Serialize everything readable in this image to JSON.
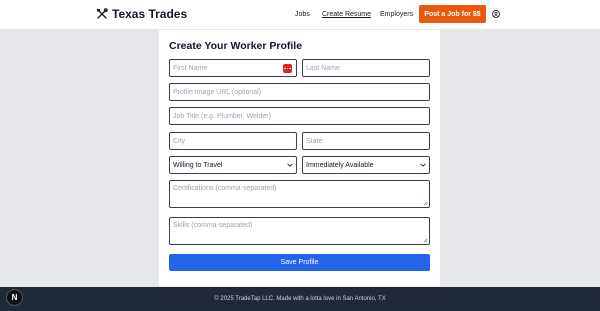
{
  "navbar": {
    "brand": "Texas Trades",
    "brand_icon": "tools-icon",
    "links": [
      "Jobs",
      "Create Resume",
      "Employers"
    ],
    "active_link": "Create Resume",
    "post_job_label": "Post a Job for $5",
    "user_icon": "user-circle-icon"
  },
  "form": {
    "title": "Create Your Worker Profile",
    "first_name_placeholder": "First Name",
    "last_name_placeholder": "Last Name",
    "profile_image_placeholder": "Profile Image URL (optional)",
    "job_title_placeholder": "Job Title (e.g. Plumber, Welder)",
    "city_placeholder": "City",
    "state_placeholder": "State",
    "travel_select_value": "Willing to Travel",
    "availability_select_value": "Immediately Available",
    "certifications_placeholder": "Certifications (comma-separated)",
    "skills_placeholder": "Skills (comma-separated)",
    "save_label": "Save Profile"
  },
  "footer": {
    "text": "© 2025 TradeTap LLC. Made with a lotta love in San Antonio, TX"
  },
  "dev_badge": "N",
  "colors": {
    "accent_orange": "#ea580c",
    "primary_blue": "#2563eb",
    "footer_bg": "#1f2937",
    "page_bg": "#e5e7eb"
  }
}
